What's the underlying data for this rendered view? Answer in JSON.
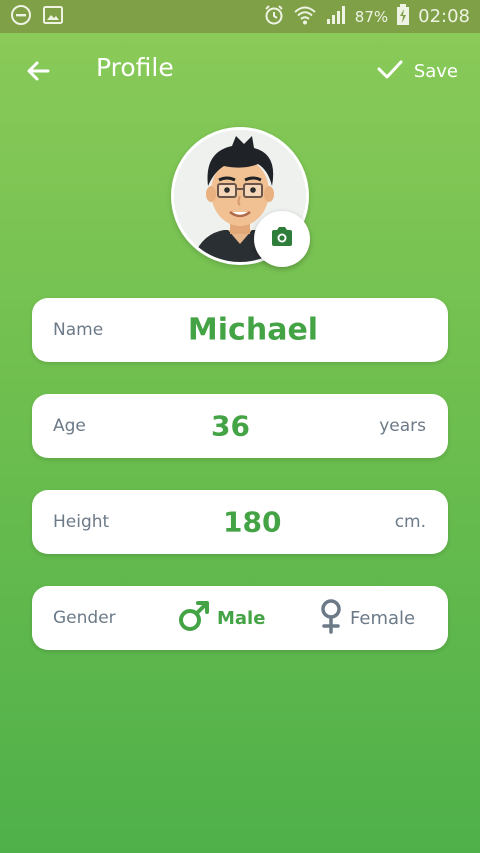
{
  "status_bar": {
    "battery": "87%",
    "time": "02:08",
    "icons": [
      "do-not-disturb-icon",
      "image-notification-icon",
      "alarm-icon",
      "wifi-icon",
      "signal-icon",
      "battery-charging-icon"
    ]
  },
  "header": {
    "title": "Profile",
    "save_label": "Save",
    "back_icon": "back-arrow-icon",
    "save_icon": "check-icon"
  },
  "profile": {
    "avatar": "cartoon-avatar",
    "camera_icon": "camera-icon",
    "name_label": "Name",
    "name_value": "Michael",
    "age_label": "Age",
    "age_value": "36",
    "age_unit": "years",
    "height_label": "Height",
    "height_value": "180",
    "height_unit": "cm.",
    "gender_label": "Gender",
    "gender_options": [
      {
        "label": "Male",
        "icon": "male-icon",
        "selected": true
      },
      {
        "label": "Female",
        "icon": "female-icon",
        "selected": false
      }
    ]
  },
  "colors": {
    "accent": "#43a345",
    "muted_text": "#6c7a88",
    "status_bar": "#7fa047"
  }
}
